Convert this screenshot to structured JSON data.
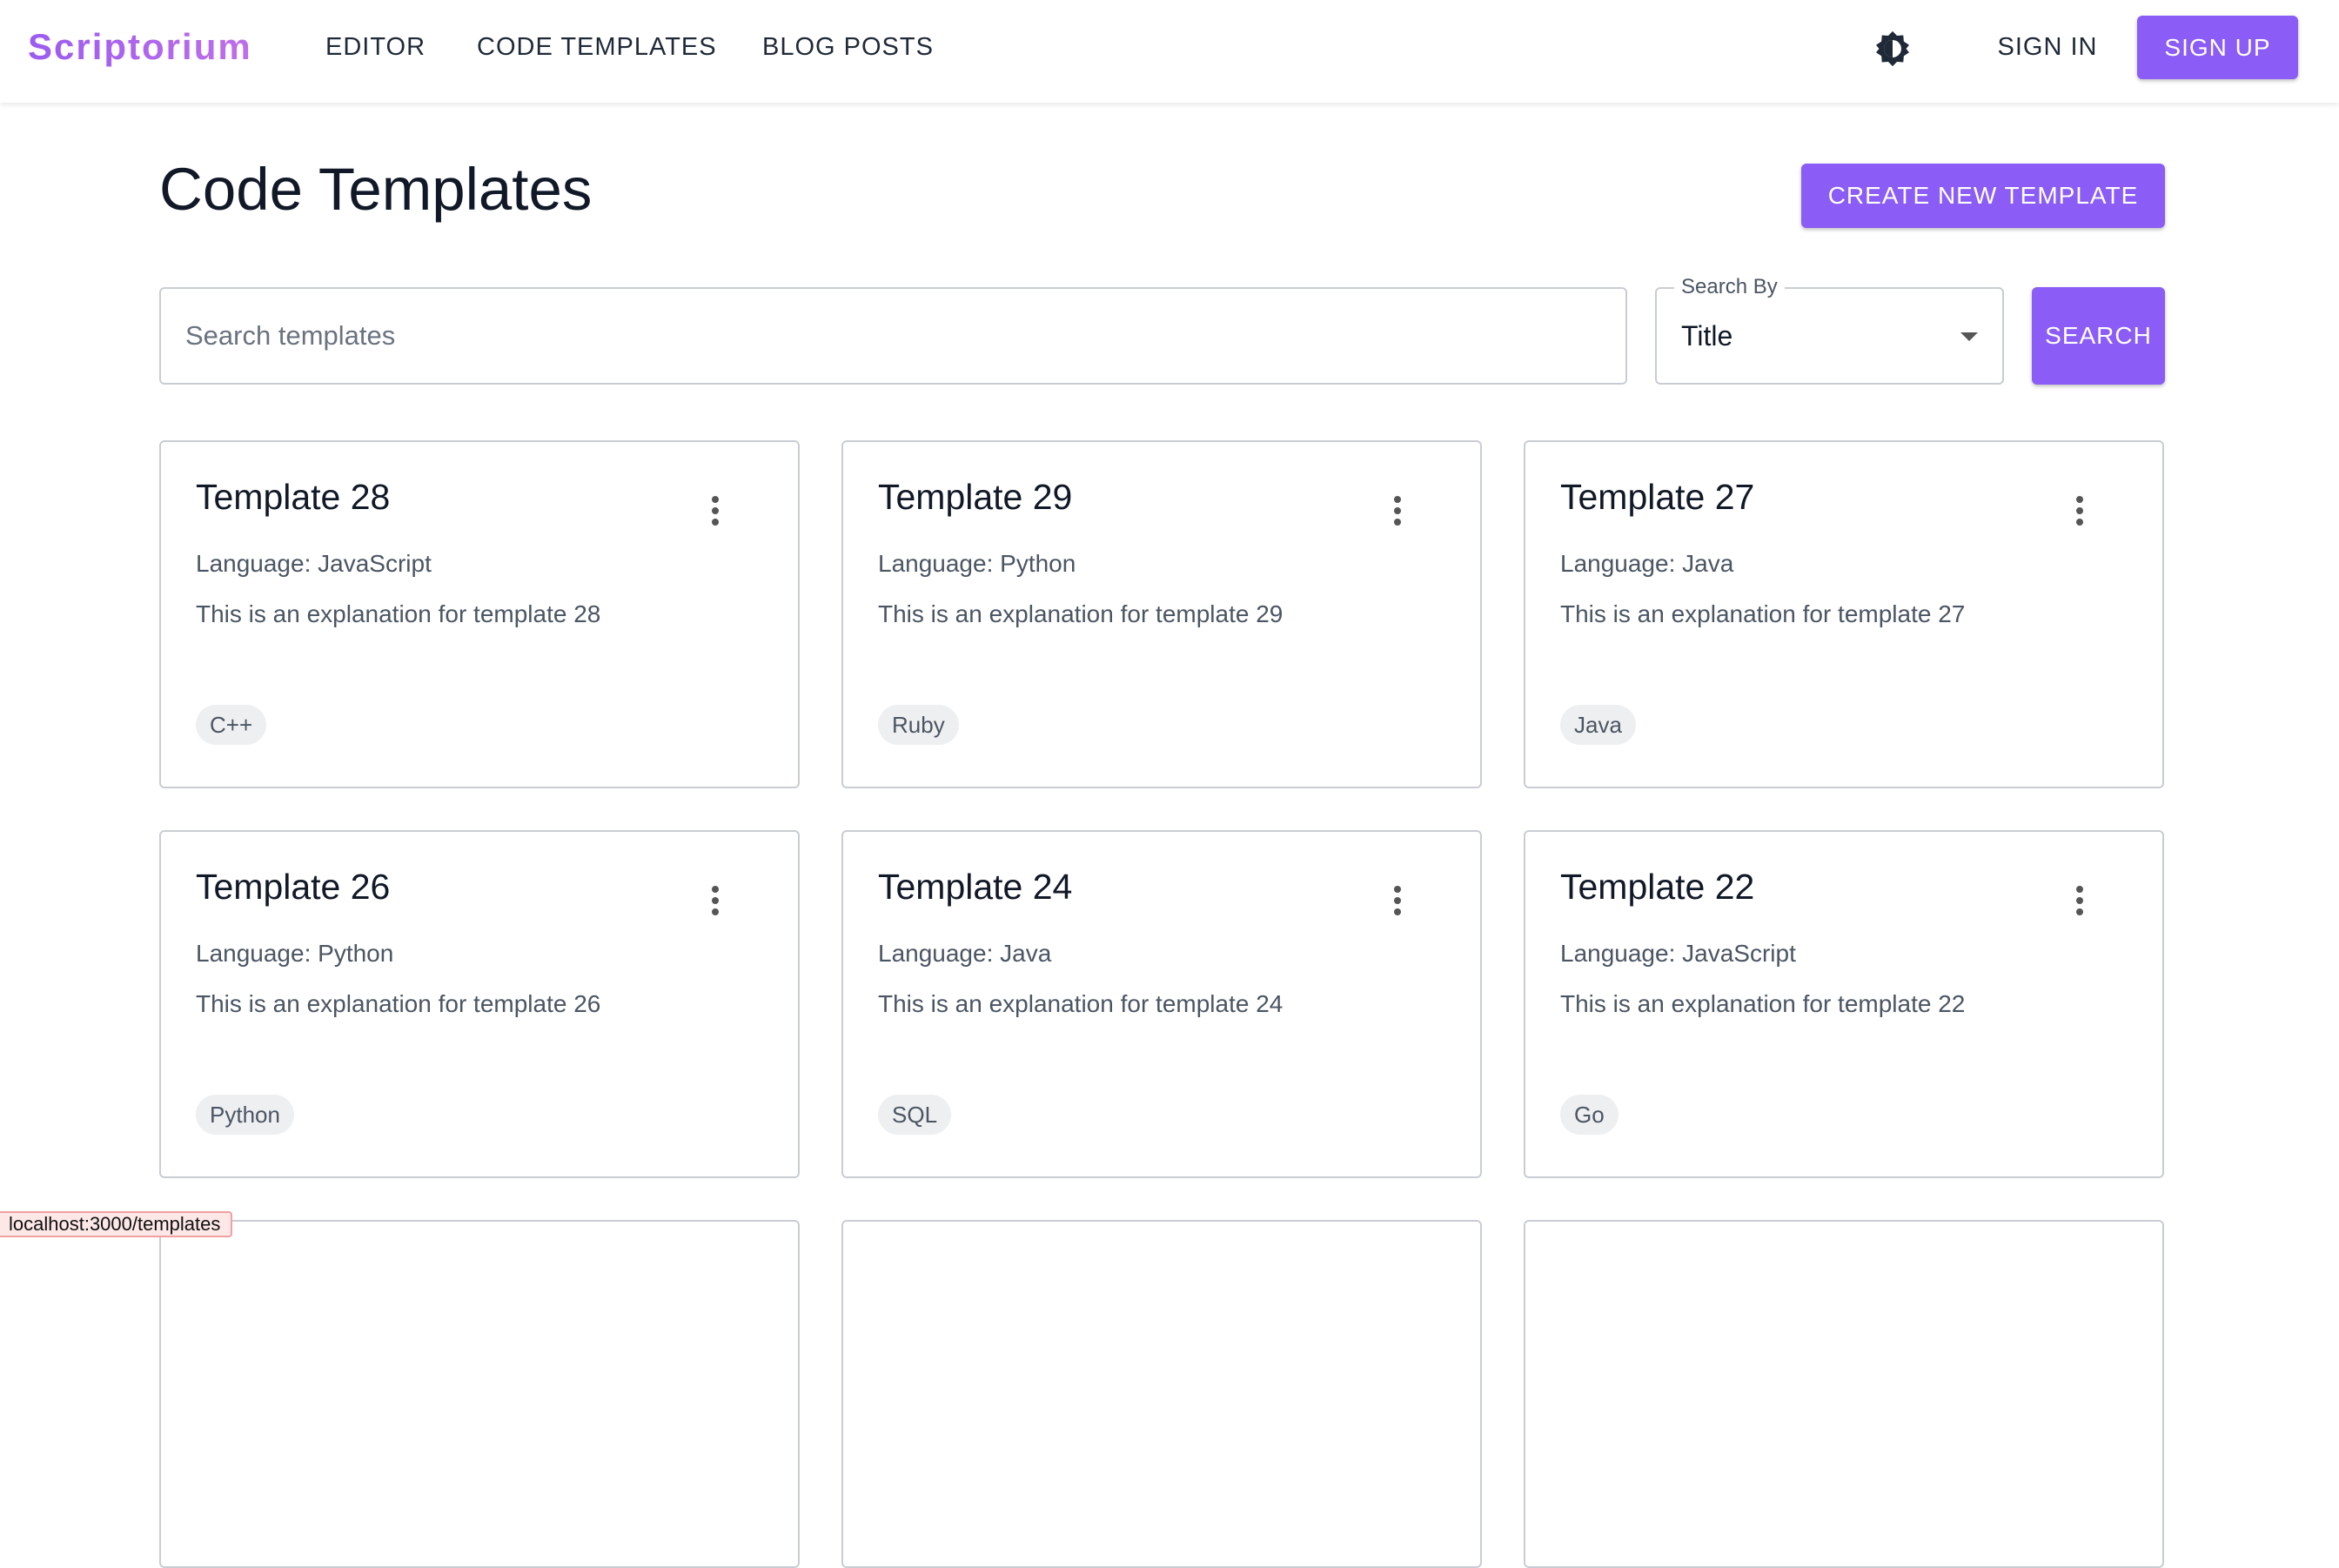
{
  "nav": {
    "brand": "Scriptorium",
    "links": [
      "EDITOR",
      "CODE TEMPLATES",
      "BLOG POSTS"
    ],
    "theme_icon": "theme-toggle-icon",
    "sign_in": "SIGN IN",
    "sign_up": "SIGN UP"
  },
  "page": {
    "title": "Code Templates",
    "create_button": "CREATE NEW TEMPLATE"
  },
  "search": {
    "placeholder": "Search templates",
    "value": "",
    "search_by_label": "Search By",
    "search_by_value": "Title",
    "search_button": "SEARCH"
  },
  "templates": [
    {
      "title": "Template 28",
      "language": "Language: JavaScript",
      "description": "This is an explanation for template 28",
      "tag": "C++"
    },
    {
      "title": "Template 29",
      "language": "Language: Python",
      "description": "This is an explanation for template 29",
      "tag": "Ruby"
    },
    {
      "title": "Template 27",
      "language": "Language: Java",
      "description": "This is an explanation for template 27",
      "tag": "Java"
    },
    {
      "title": "Template 26",
      "language": "Language: Python",
      "description": "This is an explanation for template 26",
      "tag": "Python"
    },
    {
      "title": "Template 24",
      "language": "Language: Java",
      "description": "This is an explanation for template 24",
      "tag": "SQL"
    },
    {
      "title": "Template 22",
      "language": "Language: JavaScript",
      "description": "This is an explanation for template 22",
      "tag": "Go"
    },
    {
      "title": "",
      "language": "",
      "description": "",
      "tag": ""
    },
    {
      "title": "",
      "language": "",
      "description": "",
      "tag": ""
    },
    {
      "title": "",
      "language": "",
      "description": "",
      "tag": ""
    }
  ],
  "status_bar": {
    "url": "localhost:3000/templates"
  },
  "colors": {
    "accent": "#8b5cf6",
    "brand_gradient_start": "#9b5cf0",
    "brand_gradient_end": "#c06ee8"
  }
}
